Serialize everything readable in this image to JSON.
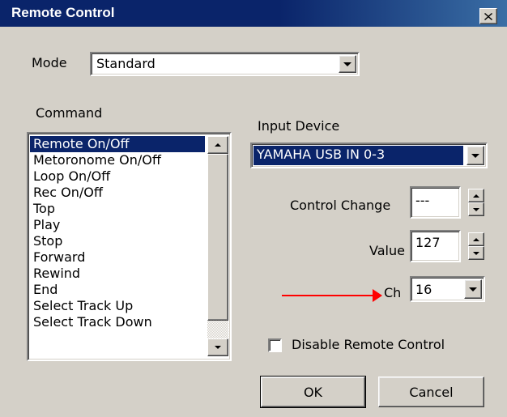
{
  "window": {
    "title": "Remote Control"
  },
  "mode": {
    "label": "Mode",
    "value": "Standard"
  },
  "command": {
    "label": "Command",
    "items": [
      "Remote On/Off",
      "Metoronome On/Off",
      "Loop On/Off",
      "Rec On/Off",
      "Top",
      "Play",
      "Stop",
      "Forward",
      "Rewind",
      "End",
      "Select Track Up",
      "Select Track Down"
    ],
    "selected": "Remote On/Off"
  },
  "input_device": {
    "label": "Input Device",
    "value": "YAMAHA USB IN 0-3"
  },
  "control_change": {
    "label": "Control Change",
    "value": "---"
  },
  "value_field": {
    "label": "Value",
    "value": "127"
  },
  "channel": {
    "label": "Ch",
    "value": "16"
  },
  "disable_remote": {
    "label": "Disable Remote Control",
    "checked": false
  },
  "buttons": {
    "ok": "OK",
    "cancel": "Cancel"
  },
  "colors": {
    "titlebar": "#0a246a",
    "selection": "#0a246a",
    "dialog_bg": "#d4d0c8",
    "annotation_arrow": "#ff0000"
  },
  "icons": {
    "close": "close-icon",
    "dropdown": "chevron-down-icon"
  }
}
